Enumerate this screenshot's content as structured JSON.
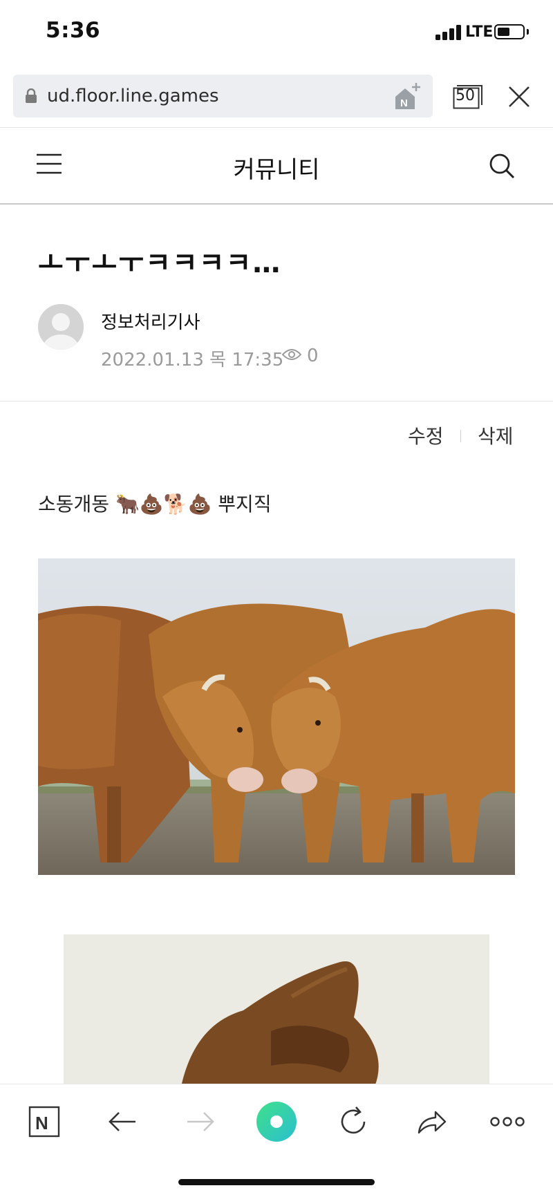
{
  "status_bar": {
    "time": "5:36",
    "network": "LTE"
  },
  "browser": {
    "url": "ud.floor.line.games",
    "tab_count": "50"
  },
  "header": {
    "title": "커뮤니티"
  },
  "post": {
    "title": "ㅗㅜㅗㅜㅋㅋㅋㅋ…",
    "author": "정보처리기사",
    "date": "2022.01.13 목 17:35",
    "views": "0",
    "edit_label": "수정",
    "delete_label": "삭제",
    "body": "소동개동 🐂💩🐕💩 뿌지직"
  },
  "icons": {
    "menu": "menu-icon",
    "search": "search-icon",
    "lock": "lock-icon",
    "add_to_home": "add-home-icon",
    "tabs": "tabs-icon",
    "close": "close-icon",
    "eye": "eye-icon",
    "naver": "naver-icon",
    "back": "back-arrow-icon",
    "forward": "forward-arrow-icon",
    "green_dot": "green-dot-icon",
    "reload": "reload-icon",
    "share": "share-icon",
    "more": "more-icon"
  },
  "colors": {
    "url_bar_bg": "#eceef1",
    "meta_gray": "#9a9a9a",
    "green_dot": "#2fd38f"
  }
}
